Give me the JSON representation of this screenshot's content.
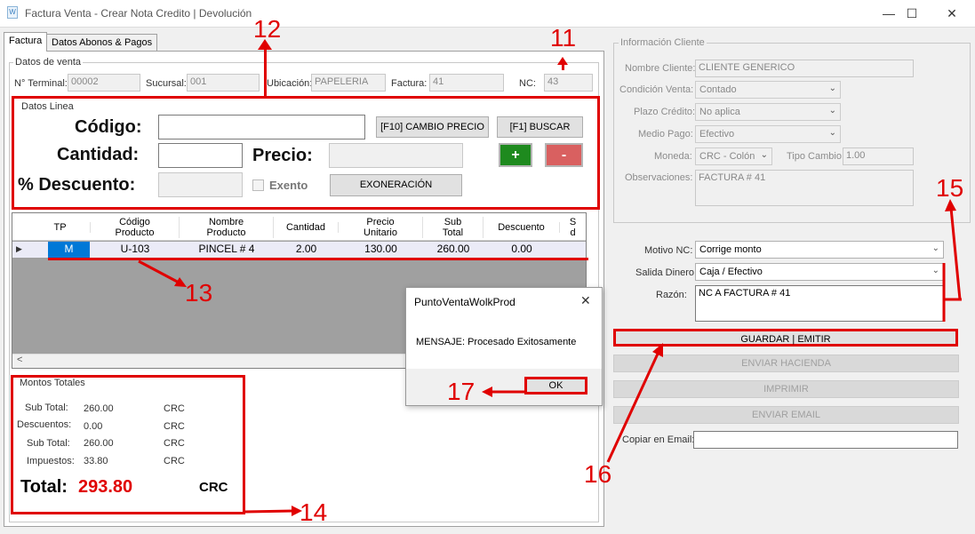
{
  "window": {
    "title": "Factura Venta - Crear Nota Credito | Devolución",
    "app_icon": "W",
    "minimize": "—",
    "maximize": "☐",
    "close": "✕"
  },
  "tabs": [
    "Factura",
    "Datos Abonos & Pagos"
  ],
  "datos_venta": {
    "title": "Datos de venta",
    "terminal_label": "N° Terminal:",
    "terminal": "00002",
    "sucursal_label": "Sucursal:",
    "sucursal": "001",
    "ubicacion_label": "Ubicación:",
    "ubicacion": "PAPELERIA",
    "factura_label": "Factura:",
    "factura": "41",
    "nc_label": "NC:",
    "nc": "43"
  },
  "datos_linea": {
    "title": "Datos Linea",
    "codigo_label": "Código:",
    "cantidad_label": "Cantidad:",
    "precio_label": "Precio:",
    "descuento_label": "% Descuento:",
    "exento_label": "Exento",
    "cambio_precio": "[F10] CAMBIO PRECIO",
    "buscar": "[F1] BUSCAR",
    "plus": "+",
    "minus": "-",
    "exoneracion": "EXONERACIÓN"
  },
  "grid": {
    "headers": [
      {
        "l1": "TP",
        "l2": ""
      },
      {
        "l1": "Código",
        "l2": "Producto"
      },
      {
        "l1": "Nombre",
        "l2": "Producto"
      },
      {
        "l1": "Cantidad",
        "l2": ""
      },
      {
        "l1": "Precio",
        "l2": "Unitario"
      },
      {
        "l1": "Sub",
        "l2": "Total"
      },
      {
        "l1": "Descuento",
        "l2": ""
      },
      {
        "l1": "S",
        "l2": "d"
      }
    ],
    "row": {
      "indicator": "▶",
      "tp": "M",
      "codigo": "U-103",
      "nombre": "PINCEL # 4",
      "cantidad": "2.00",
      "precio": "130.00",
      "subtotal": "260.00",
      "descuento": "0.00"
    },
    "scroll_left": "<"
  },
  "montos": {
    "title": "Montos Totales",
    "subtotal_label": "Sub Total:",
    "subtotal": "260.00",
    "descuentos_label": "Descuentos:",
    "descuentos": "0.00",
    "subtotal2_label": "Sub Total:",
    "subtotal2": "260.00",
    "impuestos_label": "Impuestos:",
    "impuestos": "33.80",
    "currency": "CRC",
    "total_label": "Total:",
    "total": "293.80"
  },
  "cliente": {
    "title": "Información Cliente",
    "nombre_label": "Nombre Cliente:",
    "nombre": "CLIENTE GENERICO",
    "condicion_label": "Condición Venta:",
    "condicion": "Contado",
    "plazo_label": "Plazo Crédito:",
    "plazo": "No aplica",
    "medio_label": "Medio Pago:",
    "medio": "Efectivo",
    "moneda_label": "Moneda:",
    "moneda": "CRC - Colón",
    "tipo_cambio_label": "Tipo Cambio:",
    "tipo_cambio": "1.00",
    "observaciones_label": "Observaciones:",
    "observaciones": "FACTURA  # 41"
  },
  "nc": {
    "motivo_label": "Motivo NC:",
    "motivo": "Corrige monto",
    "salida_label": "Salida Dinero:",
    "salida": "Caja / Efectivo",
    "razon_label": "Razón:",
    "razon": "NC A FACTURA # 41"
  },
  "actions": {
    "guardar": "GUARDAR | EMITIR",
    "enviar_hacienda": "ENVIAR HACIENDA",
    "imprimir": "IMPRIMIR",
    "enviar_email": "ENVIAR EMAIL",
    "copiar_label": "Copiar en Email:",
    "copiar_value": ""
  },
  "dialog": {
    "title": "PuntoVentaWolkProd",
    "close": "✕",
    "message": "MENSAJE: Procesado Exitosamente",
    "ok": "OK"
  },
  "annotations": [
    "11",
    "12",
    "13",
    "14",
    "15",
    "16",
    "17"
  ],
  "colors": {
    "annotation_red": "#e00000",
    "grid_selected": "#0078d7",
    "total_red": "#e00000",
    "plus_green": "#1e8a1e",
    "minus_red": "#d96060"
  }
}
